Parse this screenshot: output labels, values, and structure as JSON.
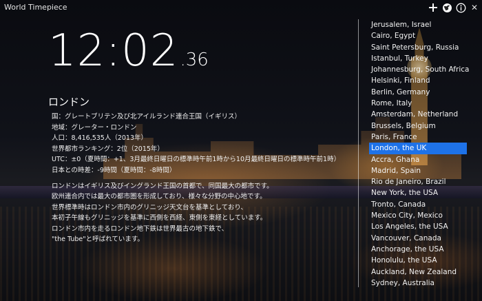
{
  "app": {
    "title": "World Timepiece"
  },
  "icons": {
    "add": "plus-icon",
    "globe": "globe-icon",
    "info": "info-icon",
    "close": "close-icon"
  },
  "clock": {
    "hm": "12:02",
    "sec": ".36"
  },
  "city": {
    "name": "ロンドン",
    "facts": [
      "国：グレートブリテン及び北アイルランド連合王国（イギリス）",
      "地域：グレーター・ロンドン",
      "人口：8,416,535人（2013年）",
      "世界都市ランキング：2位（2015年）",
      "UTC：±0（夏時間：+1、3月最終日曜日の標準時午前1時から10月最終日曜日の標準時午前1時）",
      "日本との時差：-9時間（夏時間：-8時間）"
    ],
    "description": [
      "ロンドンはイギリス及びイングランド王国の首都で、同国最大の都市です。",
      "欧州連合内では最大の都市圏を形成しており、様々な分野の中心地です。",
      "世界標準時はロンドン市内のグリニッジ天文台を基準としており、",
      "本初子午線もグリニッジを基準に西側を西経、東側を東経としています。",
      "ロンドン市内を走るロンドン地下鉄は世界最古の地下鉄で、",
      "\"the Tube\"と呼ばれています。"
    ]
  },
  "cities": [
    "Jerusalem, Israel",
    "Cairo, Egypt",
    "Saint Petersburg, Russia",
    "Istanbul, Turkey",
    "Johannesburg, South Africa",
    "Helsinki, Finland",
    "Berlin, Germany",
    "Rome, Italy",
    "Amsterdam, Netherland",
    "Brussels, Belgium",
    "Paris, France",
    "London, the UK",
    "Accra, Ghana",
    "Madrid, Spain",
    "Rio de Janeiro, Brazil",
    "New York, the USA",
    "Tronto, Canada",
    "Mexico City, Mexico",
    "Los Angeles, the USA",
    "Vancouver, Canada",
    "Anchorage, the USA",
    "Honolulu, the USA",
    "Auckland, New Zealand",
    "Sydney, Australia"
  ],
  "selected_city": "London, the UK",
  "colors": {
    "selection": "#1e72e8"
  }
}
